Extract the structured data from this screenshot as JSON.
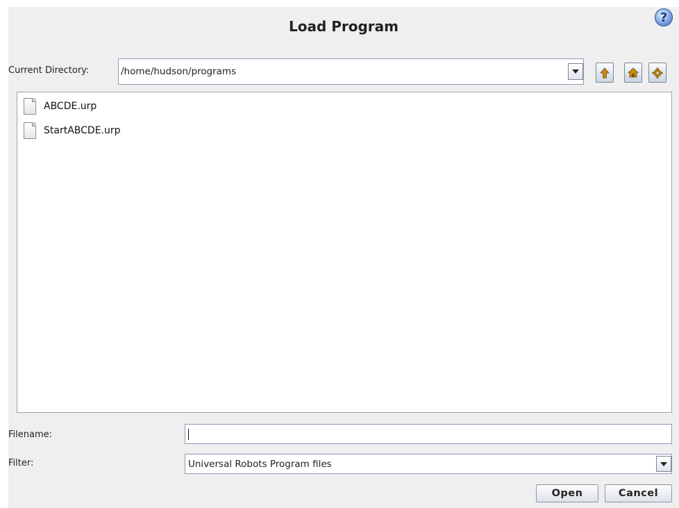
{
  "dialog": {
    "title": "Load Program",
    "help_icon": "question-mark-icon",
    "help_glyph": "?"
  },
  "directory": {
    "label": "Current Directory:",
    "value": "/home/hudson/programs",
    "nav_icons": [
      "up-arrow-icon",
      "home-icon",
      "gear-icon"
    ]
  },
  "files": [
    {
      "name": "ABCDE.urp",
      "icon": "file-icon"
    },
    {
      "name": "StartABCDE.urp",
      "icon": "file-icon"
    }
  ],
  "filename": {
    "label": "Filename:",
    "value": ""
  },
  "filter": {
    "label": "Filter:",
    "value": "Universal Robots Program files"
  },
  "buttons": {
    "open": "Open",
    "cancel": "Cancel"
  },
  "colors": {
    "dialog_bg": "#efefef",
    "field_border": "#8c9cb5",
    "help_blue": "#3b67b8"
  }
}
